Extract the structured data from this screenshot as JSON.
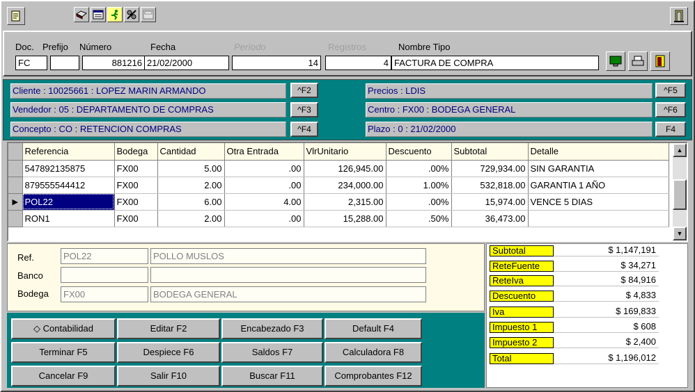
{
  "toolbar": {
    "left_icons": [
      "new-document-icon",
      "print-icon",
      "form-icon",
      "run-icon",
      "tools-icon",
      "calculator-icon"
    ],
    "right_icon": "exit-door-icon"
  },
  "header": {
    "doc_label": "Doc.",
    "prefijo_label": "Prefijo",
    "numero_label": "Número",
    "fecha_label": "Fecha",
    "periodo_label": "Período",
    "registros_label": "Registros",
    "nombre_tipo_label": "Nombre Tipo",
    "doc_value": "FC",
    "prefijo_value": "",
    "numero_value": "881216",
    "fecha_value": "21/02/2000",
    "periodo_value": "14",
    "registros_value": "4",
    "nombre_tipo_value": "FACTURA DE COMPRA"
  },
  "info": {
    "cliente": "Cliente : 10025661 : LOPEZ MARIN ARMANDO",
    "vendedor": "Vendedor : 05 : DEPARTAMENTO DE COMPRAS",
    "concepto": "Concepto : CO : RETENCION COMPRAS",
    "precios": "Precios : LDIS",
    "centro": "Centro : FX00 : BODEGA GENERAL",
    "plazo": "Plazo : 0 :   21/02/2000",
    "key_f2": "^F2",
    "key_f3": "^F3",
    "key_f4": "^F4",
    "key_f5": "^F5",
    "key_f6": "^F6",
    "key_f4b": "F4"
  },
  "grid": {
    "columns": [
      "Referencia",
      "Bodega",
      "Cantidad",
      "Otra Entrada",
      "VlrUnitario",
      "Descuento",
      "Subtotal",
      "Detalle"
    ],
    "rows": [
      [
        "547892135875",
        "FX00",
        "5.00",
        ".00",
        "126,945.00",
        ".00%",
        "729,934.00",
        "SIN GARANTIA"
      ],
      [
        "879555544412",
        "FX00",
        "2.00",
        ".00",
        "234,000.00",
        "1.00%",
        "532,818.00",
        "GARANTIA 1 AÑO"
      ],
      [
        "POL22",
        "FX00",
        "6.00",
        "4.00",
        "2,315.00",
        ".00%",
        "15,974.00",
        "VENCE 5 DIAS"
      ],
      [
        "RON1",
        "FX00",
        "2.00",
        ".00",
        "15,288.00",
        ".50%",
        "36,473.00",
        ""
      ]
    ]
  },
  "detail": {
    "ref_label": "Ref.",
    "banco_label": "Banco",
    "bodega_label": "Bodega",
    "ref_code": "POL22",
    "ref_name": "POLLO MUSLOS",
    "banco_code": "",
    "banco_name": "",
    "bodega_code": "FX00",
    "bodega_name": "BODEGA GENERAL"
  },
  "buttons": {
    "contabilidad": "Contabilidad",
    "editar": "Editar F2",
    "encabezado": "Encabezado F3",
    "default": "Default F4",
    "terminar": "Terminar F5",
    "despiece": "Despiece F6",
    "saldos": "Saldos F7",
    "calculadora": "Calculadora F8",
    "cancelar": "Cancelar F9",
    "salir": "Salir F10",
    "buscar": "Buscar F11",
    "comprobantes": "Comprobantes F12"
  },
  "totals": [
    {
      "name": "Subtotal",
      "value": "$ 1,147,191"
    },
    {
      "name": "ReteFuente",
      "value": "$ 34,271"
    },
    {
      "name": "ReteIva",
      "value": "$ 84,916"
    },
    {
      "name": "Descuento",
      "value": "$ 4,833"
    },
    {
      "name": "Iva",
      "value": "$ 169,833"
    },
    {
      "name": "Impuesto 1",
      "value": "$ 608"
    },
    {
      "name": "Impuesto 2",
      "value": "$ 2,400"
    },
    {
      "name": "Total",
      "value": "$ 1,196,012"
    }
  ],
  "colors": {
    "teal": "#008080",
    "selected_row": "#000080",
    "info_text": "#000080",
    "totals_label_bg": "#ffff00"
  }
}
